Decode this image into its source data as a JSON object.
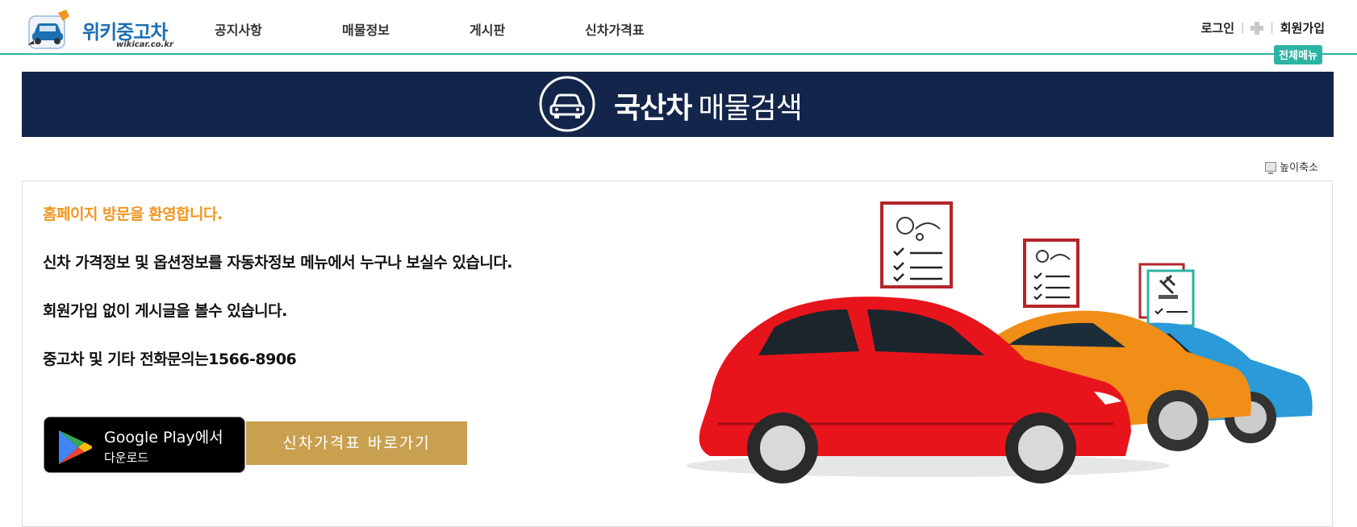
{
  "header": {
    "logo_text": "위키중고차",
    "logo_sub": "wikicar.co.kr",
    "nav": [
      "공지사항",
      "매물정보",
      "게시판",
      "신차가격표"
    ],
    "login": "로그인",
    "signup": "회원가입",
    "full_menu": "전체메뉴"
  },
  "banner": {
    "title_bold": "국산차",
    "title_light": "매물검색"
  },
  "zoom_label": "높이축소",
  "content": {
    "welcome": "홈페이지 방문을 환영합니다.",
    "lines": [
      "신차 가격정보 및 옵션정보를 자동차정보 메뉴에서 누구나 보실수 있습니다.",
      "회원가입 없이 게시글을 볼수 있습니다.",
      "중고차 및 기타 전화문의는1566-8906"
    ],
    "google_play_line1": "Google Play에서",
    "google_play_line2": "다운로드",
    "price_button": "신차가격표 바로가기"
  },
  "colors": {
    "accent_teal": "#2bb3a3",
    "banner_navy": "#13254a",
    "welcome_orange": "#f1961e",
    "button_gold": "#c9a050",
    "logo_blue": "#1b6fb5"
  },
  "icons": [
    "car-logo-icon",
    "cross-icon",
    "car-circle-icon",
    "monitor-icon",
    "google-play-icon"
  ]
}
